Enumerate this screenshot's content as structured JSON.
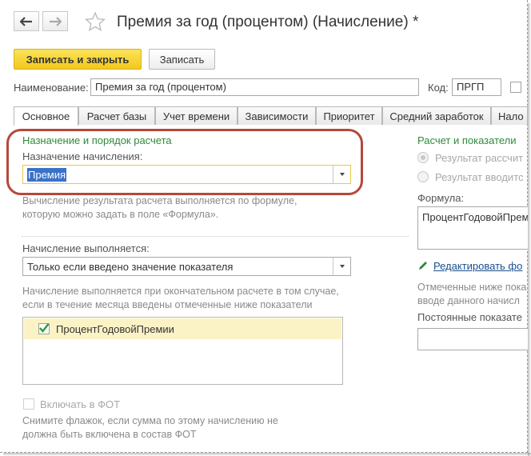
{
  "window": {
    "title": "Премия за год (процентом) (Начисление) *"
  },
  "toolbar": {
    "save_close_label": "Записать и закрыть",
    "save_label": "Записать"
  },
  "header": {
    "name_label": "Наименование:",
    "name_value": "Премия за год (процентом)",
    "code_label": "Код:",
    "code_value": "ПРГП"
  },
  "tabs": [
    {
      "label": "Основное",
      "active": true
    },
    {
      "label": "Расчет базы"
    },
    {
      "label": "Учет времени"
    },
    {
      "label": "Зависимости"
    },
    {
      "label": "Приоритет"
    },
    {
      "label": "Средний заработок"
    },
    {
      "label": "Нало"
    }
  ],
  "left": {
    "section_title": "Назначение и порядок расчета",
    "purpose_label": "Назначение начисления:",
    "purpose_value": "Премия",
    "purpose_hint_1": "Вычисление результата расчета выполняется по формуле,",
    "purpose_hint_2": "которую можно задать в поле «Формула».",
    "accrual_label": "Начисление выполняется:",
    "accrual_value": "Только если введено значение показателя",
    "accrual_hint_1": "Начисление выполняется при окончательном расчете в том случае,",
    "accrual_hint_2": "если в течение месяца введены отмеченные ниже показатели",
    "indicators": [
      {
        "label": "ПроцентГодовойПремии",
        "checked": true
      }
    ],
    "fot_label": "Включать в ФОТ",
    "fot_hint_1": "Снимите флажок, если сумма по этому начислению не",
    "fot_hint_2": "должна быть включена в состав ФОТ"
  },
  "right": {
    "section_title": "Расчет и показатели",
    "radio_1": "Результат рассчит",
    "radio_2": "Результат вводитс",
    "formula_label": "Формула:",
    "formula_value": "ПроцентГодовойПрем",
    "edit_formula_link": "Редактировать фо",
    "hint_1": "Отмеченные ниже пока",
    "hint_2": "вводе данного начисл",
    "constant_label": "Постоянные показате"
  },
  "colors": {
    "accent_green": "#2f8a3a",
    "primary_button": "#f2c81c",
    "highlight_ring": "#b4493b",
    "selection": "#3a72c9",
    "list_row": "#fbf3c6",
    "link": "#1a4f8e"
  },
  "icons": {
    "back": "arrow-left-icon",
    "forward": "arrow-right-icon",
    "favorite": "star-icon",
    "check": "checkmark-icon",
    "edit": "pencil-icon"
  }
}
